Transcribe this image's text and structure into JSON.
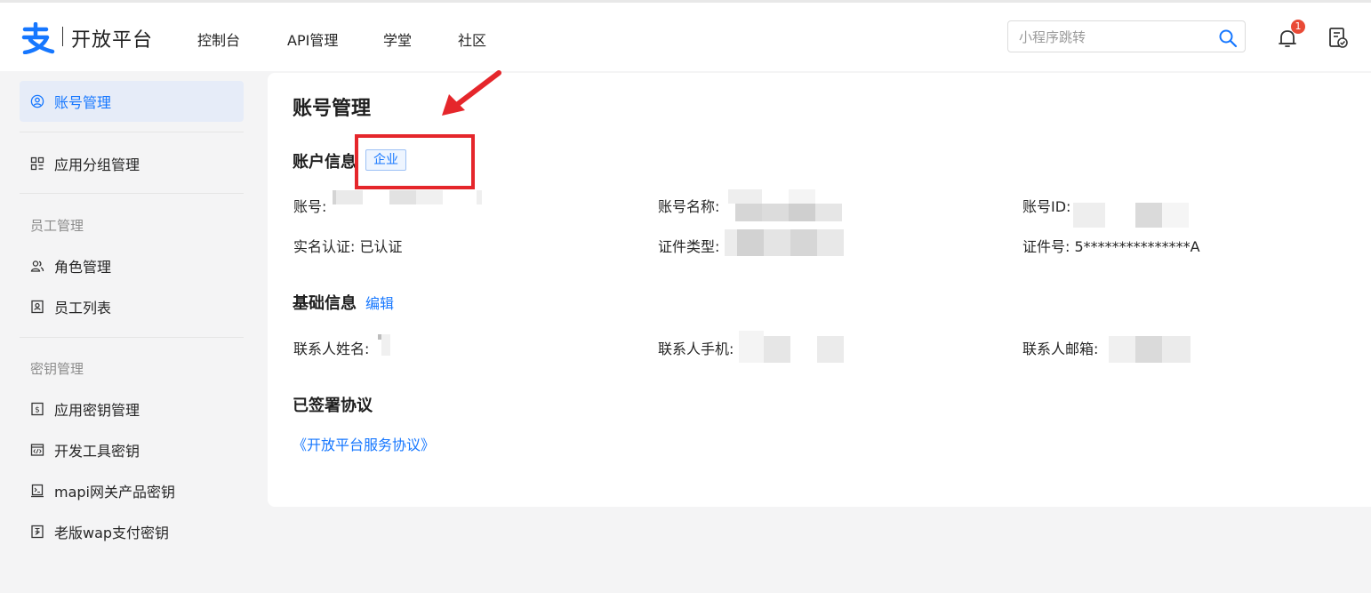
{
  "header": {
    "logo_text": "开放平台",
    "nav": [
      "控制台",
      "API管理",
      "学堂",
      "社区"
    ],
    "search_placeholder": "小程序跳转",
    "notification_count": "1"
  },
  "sidebar": {
    "items": [
      {
        "label": "账号管理",
        "icon": "user-circle-icon",
        "active": true
      },
      {
        "label": "应用分组管理",
        "icon": "grid-icon"
      },
      {
        "label": "角色管理",
        "icon": "users-icon"
      },
      {
        "label": "员工列表",
        "icon": "id-card-icon"
      },
      {
        "label": "应用密钥管理",
        "icon": "key-doc-icon"
      },
      {
        "label": "开发工具密钥",
        "icon": "code-window-icon"
      },
      {
        "label": "mapi网关产品密钥",
        "icon": "terminal-icon"
      },
      {
        "label": "老版wap支付密钥",
        "icon": "payment-doc-icon"
      }
    ],
    "groups": [
      "员工管理",
      "密钥管理"
    ]
  },
  "main": {
    "title": "账号管理",
    "account_info": {
      "title": "账户信息",
      "tag": "企业",
      "fields": {
        "account": "账号:",
        "account_name": "账号名称:",
        "account_id": "账号ID:",
        "real_name": "实名认证:",
        "real_name_value": "已认证",
        "cert_type": "证件类型:",
        "cert_no": "证件号:",
        "cert_no_value": "5***************A"
      }
    },
    "basic_info": {
      "title": "基础信息",
      "edit": "编辑",
      "fields": {
        "contact_name": "联系人姓名:",
        "contact_phone": "联系人手机:",
        "contact_email": "联系人邮箱:"
      }
    },
    "agreements": {
      "title": "已签署协议",
      "items": [
        "《开放平台服务协议》"
      ]
    }
  },
  "colors": {
    "accent": "#1677ff",
    "annotation": "#e5262b",
    "active_bg": "#e6ecf8"
  }
}
